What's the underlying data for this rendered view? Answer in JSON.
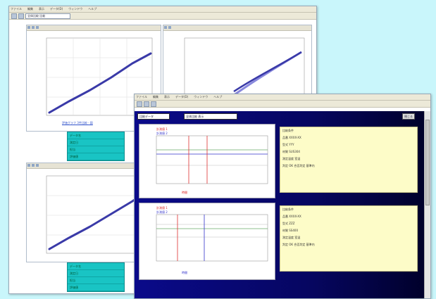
{
  "back_window": {
    "menu": [
      "ファイル",
      "編集",
      "表示",
      "データ(D)",
      "ウィンドウ",
      "ヘルプ"
    ],
    "toolbar_field": "全体比較 比較",
    "caption_top": "評価グラフ 3件比較 - 図",
    "info_box_top": [
      "データ名",
      "測定日",
      "担当",
      "評価値"
    ],
    "info_box_bottom": [
      "データ名",
      "測定日",
      "担当",
      "評価値"
    ]
  },
  "front_window": {
    "menu": [
      "ファイル",
      "編集",
      "表示",
      "データ(D)",
      "ウィンドウ",
      "ヘルプ"
    ],
    "header_tab_1": "比較データ",
    "header_tab_2": "全体比較 表示",
    "header_button": "閉じる",
    "panel_1": {
      "legend_1": "計測値 1",
      "legend_2": "計測値 2",
      "axis_caption": "時間",
      "info_lines": [
        "比較条件",
        "品番 XXXX-XX",
        "型式 YYY",
        "材質 SUS304",
        "測定温度 室温",
        "判定 OK  合否判定 基準内"
      ]
    },
    "panel_2": {
      "legend_1": "計測値 1",
      "legend_2": "計測値 2",
      "axis_caption": "時間",
      "info_lines": [
        "比較条件",
        "品番 XXXX-XX",
        "型式 ZZZ",
        "材質 SS400",
        "測定温度 室温",
        "判定 OK  合否判定 基準内"
      ]
    }
  },
  "colors": {
    "background": "#c9f6fb",
    "plot_line": "#3a3aa8",
    "navy": "#06066a",
    "teal": "#19c4c4",
    "info_bg": "#fdfcc8",
    "marker_red": "#e03030"
  }
}
